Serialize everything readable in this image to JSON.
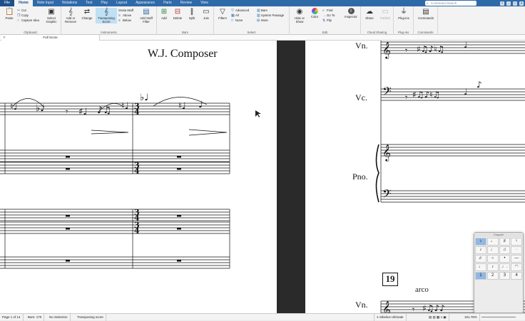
{
  "tabs": [
    "File",
    "Home",
    "Note Input",
    "Notations",
    "Text",
    "Play",
    "Layout",
    "Appearance",
    "Parts",
    "Review",
    "View"
  ],
  "search": {
    "placeholder": "Command Search"
  },
  "ribbon": {
    "clipboard": {
      "paste": "Paste",
      "cut": "Cut",
      "copy": "Copy",
      "capture": "Capture Idea",
      "select_graphic": "Select Graphic",
      "label": "Clipboard"
    },
    "instruments": {
      "add_remove": "Add or Remove",
      "change": "Change",
      "transposing": "Transposing Score",
      "ossia": "Ossia Staff",
      "above": "Above",
      "below": "Below",
      "add_staff_filter": "Add Staff Filter",
      "label": "Instruments"
    },
    "bars": {
      "add": "Add",
      "delete": "Delete",
      "split": "Split",
      "join": "Join",
      "label": "Bars"
    },
    "select": {
      "filters": "Filters",
      "advanced": "Advanced",
      "all": "All",
      "none": "None",
      "bars": "Bars",
      "system_passage": "System Passage",
      "more": "More",
      "label": "Select"
    },
    "edit": {
      "hide_show": "Hide or Show",
      "color": "Color",
      "find": "Find",
      "goto": "Go To",
      "flip": "Flip",
      "inspector": "Inspector",
      "label": "Edit"
    },
    "cloud": {
      "share": "Share",
      "publish": "Publish",
      "label": "Cloud Sharing"
    },
    "plugins": {
      "plugins": "Plug-ins",
      "label": "Plug-ins"
    },
    "commands": {
      "commands": "Commands",
      "label": "Commands"
    }
  },
  "document_tab": "Full Score",
  "score": {
    "composer": "W.J. Composer",
    "instruments_right": [
      "Vn.",
      "Vc.",
      "Pno.",
      "Vn."
    ],
    "rehearsal": "19",
    "arco": "arco"
  },
  "status": {
    "page": "Page 1 of 14",
    "bars": "Bars: 170",
    "selection": "No Selection",
    "mode": "Transposing score",
    "edition": "Sibelius Ultimate",
    "zoom": "161.78%"
  },
  "keypad": {
    "title": "Keypad",
    "keys": [
      "♭",
      "♩",
      "♯",
      "♮",
      "♪",
      "♩",
      "♫",
      "·",
      "♬",
      "○",
      "•",
      "—",
      "♩",
      "♪",
      "♩.",
      "◠",
      "1",
      "2",
      "3",
      "4"
    ]
  }
}
